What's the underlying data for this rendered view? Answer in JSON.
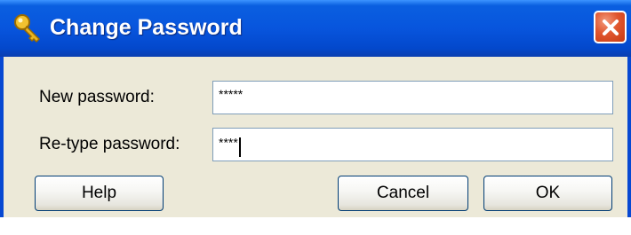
{
  "window": {
    "title": "Change Password",
    "icon": "key-icon",
    "close_icon": "close-icon"
  },
  "form": {
    "new_password_label": "New password:",
    "new_password_value": "*****",
    "retype_password_label": "Re-type password:",
    "retype_password_value": "****"
  },
  "buttons": {
    "help": "Help",
    "cancel": "Cancel",
    "ok": "OK"
  },
  "colors": {
    "titlebar": "#0855dd",
    "dialog_background": "#ece9d8",
    "close_button": "#e0562f",
    "field_border": "#7f9db9"
  }
}
